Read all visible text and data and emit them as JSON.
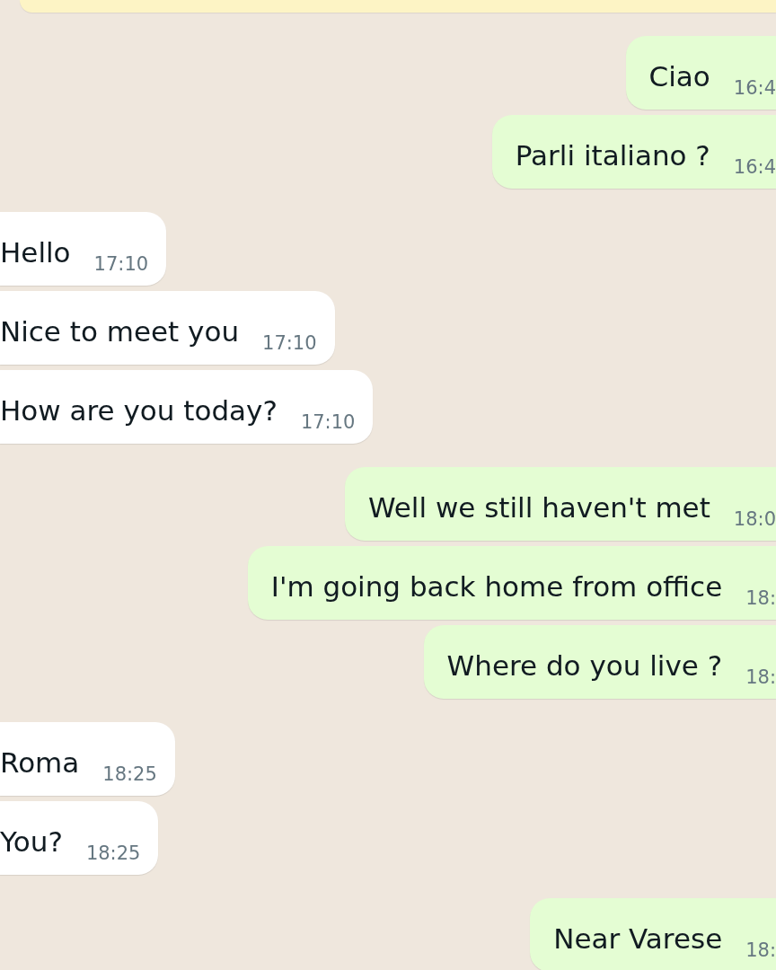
{
  "notice_banner": {
    "kind": "notice"
  },
  "messages": [
    {
      "kind": "outgoing",
      "text": "Ciao",
      "time": "16:4"
    },
    {
      "kind": "outgoing",
      "text": "Parli italiano ?",
      "time": "16:4"
    },
    {
      "kind": "incoming",
      "text": "Hello",
      "time": "17:10"
    },
    {
      "kind": "incoming",
      "text": "Nice to meet you",
      "time": "17:10"
    },
    {
      "kind": "incoming",
      "text": "How are you today?",
      "time": "17:10"
    },
    {
      "kind": "outgoing",
      "text": "Well we still haven't met",
      "time": "18:0"
    },
    {
      "kind": "outgoing",
      "text": "I'm going back home from office",
      "time": "18:"
    },
    {
      "kind": "outgoing",
      "text": "Where do you live ?",
      "time": "18:"
    },
    {
      "kind": "incoming",
      "text": "Roma",
      "time": "18:25"
    },
    {
      "kind": "incoming",
      "text": "You?",
      "time": "18:25"
    },
    {
      "kind": "outgoing",
      "text": "Near Varese",
      "time": "18:"
    }
  ]
}
